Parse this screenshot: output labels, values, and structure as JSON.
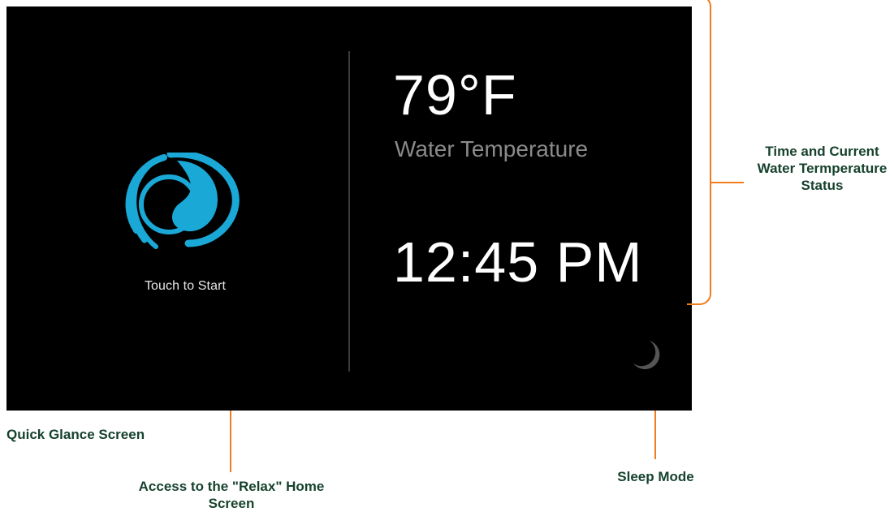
{
  "screen": {
    "touch_label": "Touch to Start",
    "temperature": "79°F",
    "temperature_label": "Water Temperature",
    "time": "12:45 PM",
    "logo_icon": "wave-swirl-logo",
    "sleep_icon": "crescent-moon-icon"
  },
  "annotations": {
    "status": "Time and Current Water Termperature Status",
    "screen_name": "Quick Glance Screen",
    "relax_access": "Access to the \"Relax\" Home Screen",
    "sleep": "Sleep Mode"
  },
  "colors": {
    "accent": "#1aa8d6",
    "callout": "#f07c1e",
    "annotation_text": "#16422e"
  }
}
